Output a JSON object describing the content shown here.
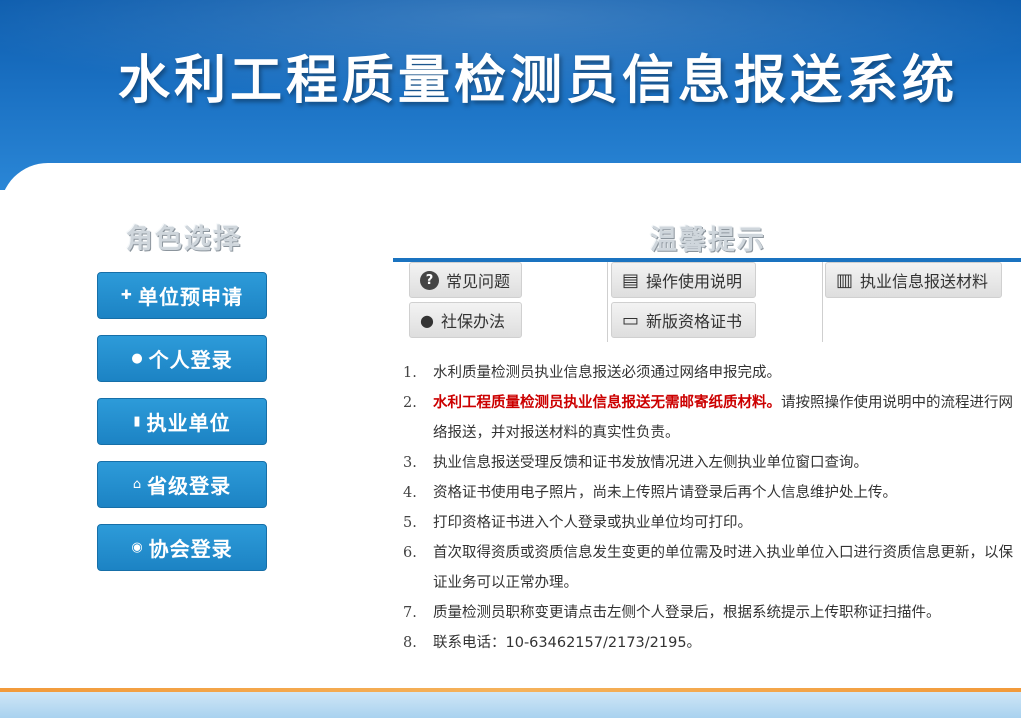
{
  "header": {
    "title": "水利工程质量检测员信息报送系统"
  },
  "roles": {
    "title": "角色选择",
    "buttons": [
      {
        "label": "单位预申请",
        "icon": "user-plus-icon",
        "glyph": "✚"
      },
      {
        "label": "个人登录",
        "icon": "user-icon",
        "glyph": "●"
      },
      {
        "label": "执业单位",
        "icon": "building-icon",
        "glyph": "▮"
      },
      {
        "label": "省级登录",
        "icon": "institution-icon",
        "glyph": "⌂"
      },
      {
        "label": "协会登录",
        "icon": "globe-icon",
        "glyph": "◉"
      }
    ]
  },
  "tips": {
    "title": "温馨提示",
    "tabs": [
      {
        "label": "常见问题",
        "icon": "question-circle-icon",
        "glyph": "?"
      },
      {
        "label": "操作使用说明",
        "icon": "book-icon",
        "glyph": "▤"
      },
      {
        "label": "执业信息报送材料",
        "icon": "newspaper-icon",
        "glyph": "▥"
      },
      {
        "label": "社保办法",
        "icon": "person-icon",
        "glyph": "●"
      },
      {
        "label": "新版资格证书",
        "icon": "credit-card-icon",
        "glyph": "▭"
      }
    ],
    "notices": [
      {
        "num": "1.",
        "text": "水利质量检测员执业信息报送必须通过网络申报完成。"
      },
      {
        "num": "2.",
        "red": "水利工程质量检测员执业信息报送无需邮寄纸质材料。",
        "text": "请按照操作使用说明中的流程进行网络报送，并对报送材料的真实性负责。"
      },
      {
        "num": "3.",
        "text": "执业信息报送受理反馈和证书发放情况进入左侧执业单位窗口查询。"
      },
      {
        "num": "4.",
        "text": "资格证书使用电子照片，尚未上传照片请登录后再个人信息维护处上传。"
      },
      {
        "num": "5.",
        "text": "打印资格证书进入个人登录或执业单位均可打印。"
      },
      {
        "num": "6.",
        "text": "首次取得资质或资质信息发生变更的单位需及时进入执业单位入口进行资质信息更新，以保证业务可以正常办理。"
      },
      {
        "num": "7.",
        "text": "质量检测员职称变更请点击左侧个人登录后，根据系统提示上传职称证扫描件。"
      },
      {
        "num": "8.",
        "text": "联系电话：10-63462157/2173/2195。"
      }
    ]
  }
}
